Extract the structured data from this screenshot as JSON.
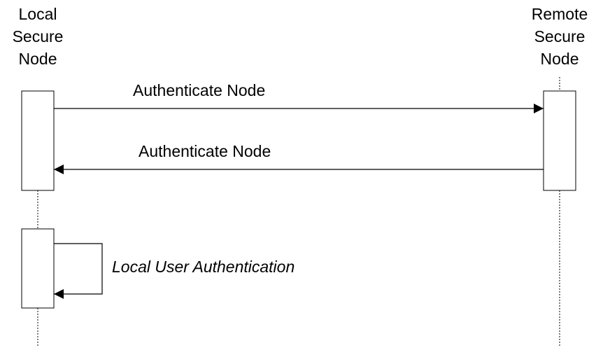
{
  "participants": [
    {
      "name": "Local\nSecure\nNode"
    },
    {
      "name": "Remote\nSecure\nNode"
    }
  ],
  "messages": [
    {
      "label": "Authenticate Node",
      "from": "Local Secure Node",
      "to": "Remote Secure Node"
    },
    {
      "label": "Authenticate Node",
      "from": "Remote Secure Node",
      "to": "Local Secure Node"
    },
    {
      "label": "Local User Authentication",
      "from": "Local Secure Node",
      "to": "Local Secure Node",
      "style": "italic"
    }
  ],
  "colors": {
    "line": "#000000",
    "activation_fill": "#ffffff",
    "background": "#ffffff"
  }
}
